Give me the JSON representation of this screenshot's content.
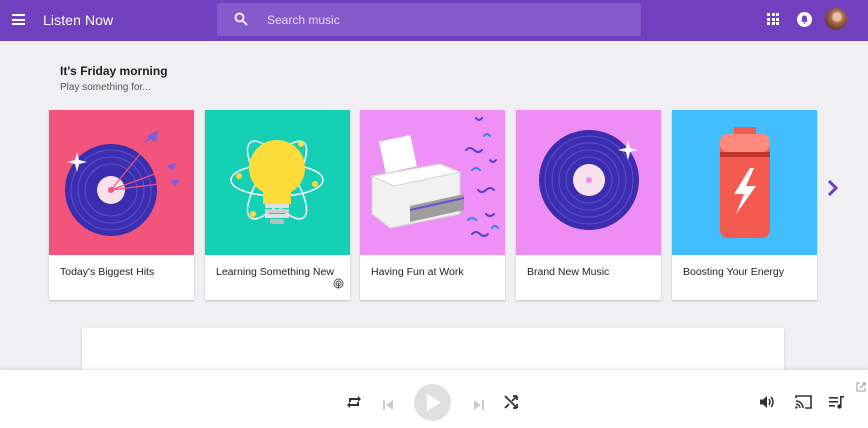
{
  "header": {
    "title": "Listen Now",
    "search_placeholder": "Search music"
  },
  "greeting": {
    "title": "It's Friday morning",
    "subtitle": "Play something for..."
  },
  "cards": [
    {
      "label": "Today's Biggest Hits",
      "bg": "#f2547c"
    },
    {
      "label": "Learning Something New",
      "bg": "#15d0b4",
      "badge": "podcast-icon"
    },
    {
      "label": "Having Fun at Work",
      "bg": "#ee90f6"
    },
    {
      "label": "Brand New Music",
      "bg": "#ee8ef4"
    },
    {
      "label": "Boosting Your Energy",
      "bg": "#44bdfc"
    }
  ],
  "colors": {
    "accent": "#7040bf",
    "search_bg": "#8659cb",
    "page_bg": "#f0eff1"
  },
  "player": {
    "controls": [
      "repeat-icon",
      "previous-icon",
      "play-icon",
      "next-icon",
      "shuffle-icon",
      "volume-icon",
      "cast-icon",
      "queue-icon",
      "popout-icon"
    ]
  }
}
